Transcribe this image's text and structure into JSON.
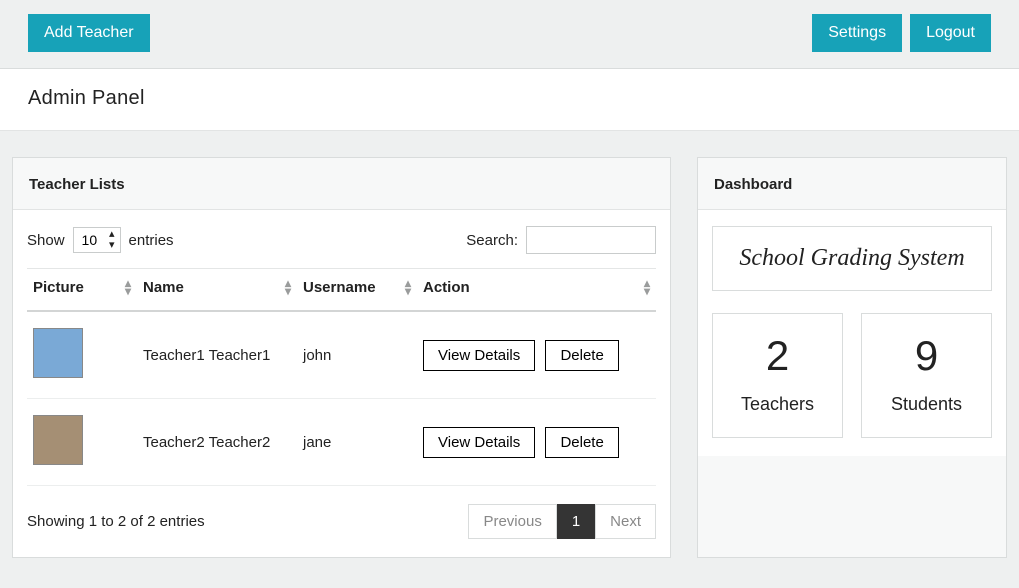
{
  "topbar": {
    "add_teacher": "Add Teacher",
    "settings": "Settings",
    "logout": "Logout"
  },
  "page_title": "Admin Panel",
  "teacher_card": {
    "header": "Teacher Lists",
    "show_label": "Show",
    "entries_label": "entries",
    "page_size": "10",
    "search_label": "Search:",
    "columns": {
      "picture": "Picture",
      "name": "Name",
      "username": "Username",
      "action": "Action"
    },
    "actions": {
      "view": "View Details",
      "delete": "Delete"
    },
    "rows": [
      {
        "name": "Teacher1 Teacher1",
        "username": "john"
      },
      {
        "name": "Teacher2 Teacher2",
        "username": "jane"
      }
    ],
    "footer_info": "Showing 1 to 2 of 2 entries",
    "pager": {
      "previous": "Previous",
      "current": "1",
      "next": "Next"
    }
  },
  "dashboard": {
    "header": "Dashboard",
    "brand": "School Grading System",
    "stat_teachers": {
      "count": "2",
      "label": "Teachers"
    },
    "stat_students": {
      "count": "9",
      "label": "Students"
    }
  }
}
